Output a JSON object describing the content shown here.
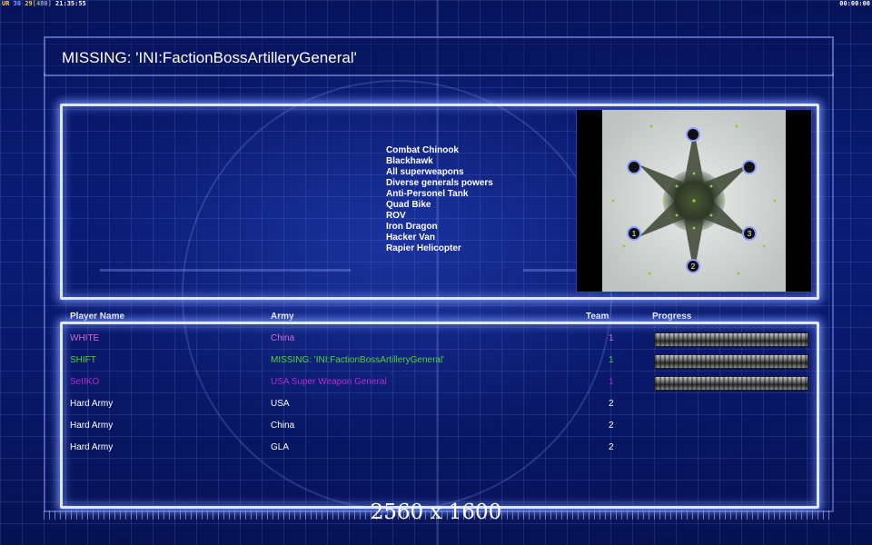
{
  "status_bar": {
    "ur": "UR",
    "n1": "30",
    "n2": "29",
    "n3": "[480]",
    "clock": "21:35:55",
    "timer": "00:00:00"
  },
  "header": {
    "title": "MISSING: 'INI:FactionBossArtilleryGeneral'"
  },
  "general_info": {
    "units": [
      "Combat Chinook",
      "Blackhawk",
      "All superweapons",
      "Diverse generals powers",
      "Anti-Personel Tank",
      "Quad Bike",
      "ROV",
      "Iron Dragon",
      "Hacker Van",
      "Rapier Helicopter"
    ]
  },
  "map": {
    "start_positions": [
      "1",
      "2",
      "3"
    ]
  },
  "table": {
    "headers": {
      "player": "Player Name",
      "army": "Army",
      "team": "Team",
      "progress": "Progress"
    },
    "rows": [
      {
        "name": "WHITE",
        "army": "China",
        "team": "1",
        "color": "#d36ad9",
        "progress": true
      },
      {
        "name": "SHIFT",
        "army": "MISSING: 'INI:FactionBossArtilleryGeneral'",
        "team": "1",
        "color": "#4fd23a",
        "progress": true
      },
      {
        "name": "SeIIKO",
        "army": "USA Super Weapon General",
        "team": "1",
        "color": "#b42ad0",
        "progress": true
      },
      {
        "name": "Hard Army",
        "army": "USA",
        "team": "2",
        "color": "#ffffff",
        "progress": false
      },
      {
        "name": "Hard Army",
        "army": "China",
        "team": "2",
        "color": "#ffffff",
        "progress": false
      },
      {
        "name": "Hard Army",
        "army": "GLA",
        "team": "2",
        "color": "#ffffff",
        "progress": false
      }
    ]
  },
  "resolution_label": "2560 x 1600",
  "colors": {
    "background": "#071253",
    "panel_glow": "#dfe6ff"
  }
}
